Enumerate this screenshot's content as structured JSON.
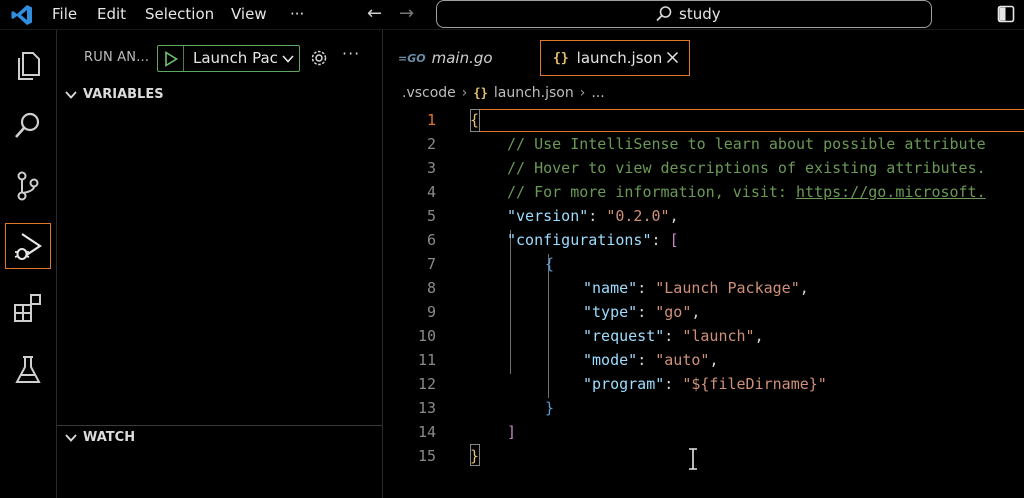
{
  "menubar": {
    "items": [
      "File",
      "Edit",
      "Selection",
      "View",
      "···"
    ],
    "search_text": "study"
  },
  "sidebar": {
    "title": "RUN AN...",
    "launch_config": "Launch Package",
    "more": "···",
    "variables_label": "VARIABLES",
    "watch_label": "WATCH"
  },
  "editor": {
    "tabs": [
      {
        "label": "main.go",
        "icon": "go-icon"
      },
      {
        "label": "launch.json",
        "icon": "json-braces-icon"
      }
    ],
    "breadcrumb": {
      "folder": ".vscode",
      "file": "launch.json",
      "tail": "..."
    },
    "line_numbers": [
      "1",
      "2",
      "3",
      "4",
      "5",
      "6",
      "7",
      "8",
      "9",
      "10",
      "11",
      "12",
      "13",
      "14",
      "15"
    ],
    "code": {
      "l1": "{",
      "l2": "// Use IntelliSense to learn about possible attribute",
      "l3": "// Hover to view descriptions of existing attributes.",
      "l4_prefix": "// For more information, visit: ",
      "l4_link": "https://go.microsoft.",
      "l5_key": "\"version\"",
      "l5_val": "\"0.2.0\"",
      "l6_key": "\"configurations\"",
      "l6_open": "[",
      "l7": "{",
      "l8_key": "\"name\"",
      "l8_val": "\"Launch Package\"",
      "l9_key": "\"type\"",
      "l9_val": "\"go\"",
      "l10_key": "\"request\"",
      "l10_val": "\"launch\"",
      "l11_key": "\"mode\"",
      "l11_val": "\"auto\"",
      "l12_key": "\"program\"",
      "l12_val": "\"${fileDirname}\"",
      "l13": "}",
      "l14": "]",
      "l15": "}",
      "colon": ": ",
      "comma": ","
    }
  },
  "colors": {
    "accent": "#e0762a",
    "run_green": "#5fa85f",
    "comment": "#6a9955",
    "json_key": "#9cdcfe",
    "json_string": "#ce9178"
  }
}
